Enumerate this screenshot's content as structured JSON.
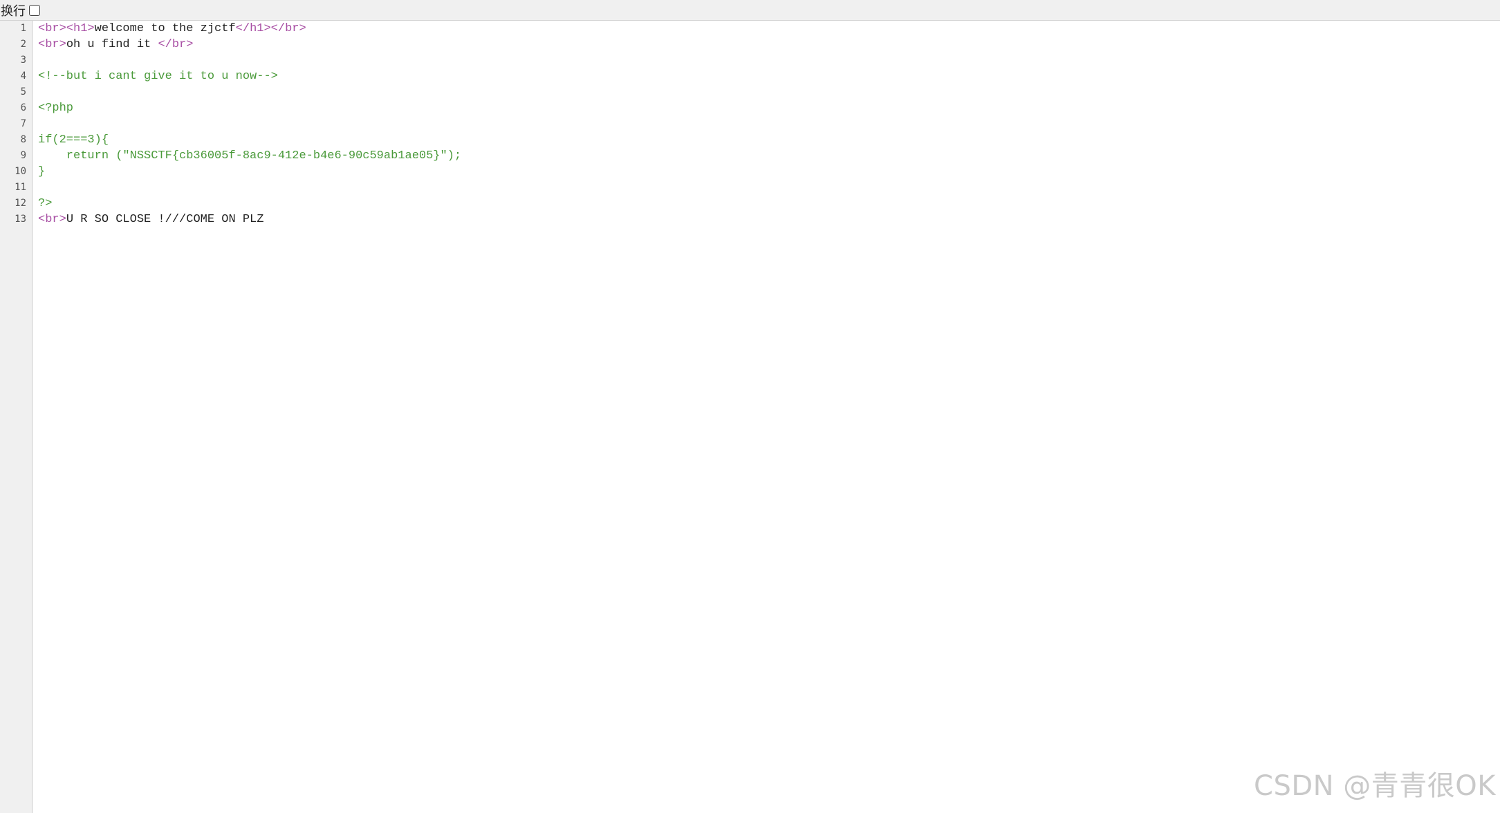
{
  "toolbar": {
    "wrap_label": "换行",
    "wrap_checked": false
  },
  "editor": {
    "line_numbers": [
      "1",
      "2",
      "3",
      "4",
      "5",
      "6",
      "7",
      "8",
      "9",
      "10",
      "11",
      "12",
      "13"
    ],
    "lines": [
      [
        {
          "t": "tag",
          "v": "<br><h1>"
        },
        {
          "t": "text",
          "v": "welcome to the zjctf"
        },
        {
          "t": "tag",
          "v": "</h1></br>"
        }
      ],
      [
        {
          "t": "tag",
          "v": "<br>"
        },
        {
          "t": "text",
          "v": "oh u find it "
        },
        {
          "t": "tag",
          "v": "</br>"
        }
      ],
      [],
      [
        {
          "t": "comment",
          "v": "<!--but i cant give it to u now-->"
        }
      ],
      [],
      [
        {
          "t": "php",
          "v": "<?php"
        }
      ],
      [],
      [
        {
          "t": "php",
          "v": "if(2===3){"
        }
      ],
      [
        {
          "t": "php",
          "v": "    return (\"NSSCTF{cb36005f-8ac9-412e-b4e6-90c59ab1ae05}\");"
        }
      ],
      [
        {
          "t": "php",
          "v": "}"
        }
      ],
      [],
      [
        {
          "t": "php",
          "v": "?>"
        }
      ],
      [
        {
          "t": "tag",
          "v": "<br>"
        },
        {
          "t": "text",
          "v": "U R SO CLOSE !///COME ON PLZ"
        }
      ]
    ]
  },
  "watermark": "CSDN @青青很OK"
}
